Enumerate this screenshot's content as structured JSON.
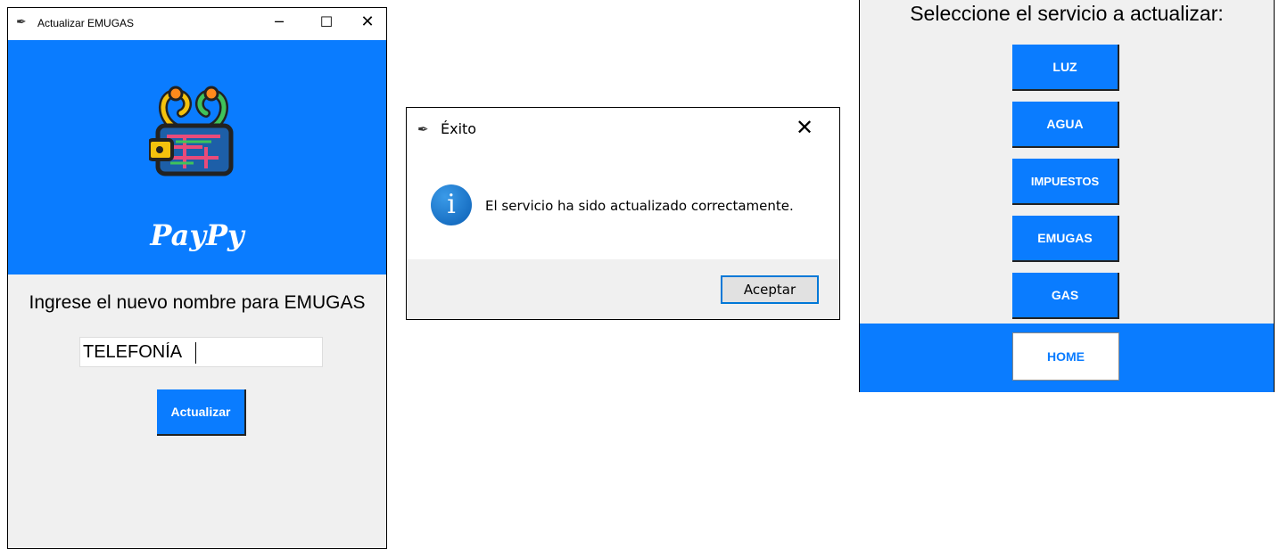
{
  "update_window": {
    "title": "Actualizar EMUGAS",
    "brand": "PayPy",
    "prompt": "Ingrese el nuevo nombre para EMUGAS",
    "input_value": "TELEFONÍA",
    "update_button": "Actualizar"
  },
  "success_dialog": {
    "title": "Éxito",
    "message": "El servicio ha sido actualizado correctamente.",
    "accept_button": "Aceptar"
  },
  "service_window": {
    "heading": "Seleccione el servicio a actualizar:",
    "services": [
      "LUZ",
      "AGUA",
      "IMPUESTOS",
      "EMUGAS",
      "GAS"
    ],
    "home_button": "HOME"
  },
  "colors": {
    "accent_blue": "#0a7cff",
    "panel_gray": "#f0f0f0"
  }
}
